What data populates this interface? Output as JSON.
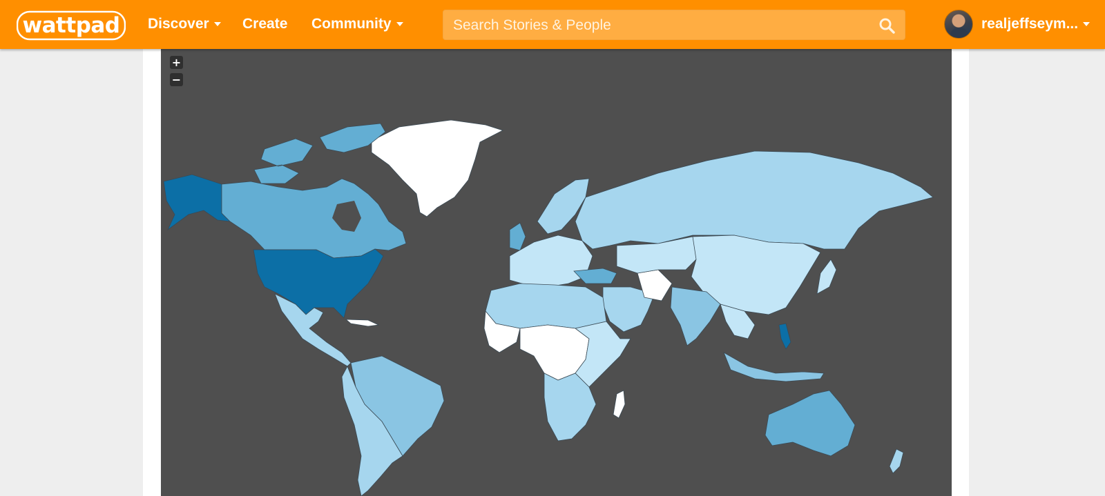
{
  "header": {
    "logo_text": "wattpad",
    "nav": {
      "discover": "Discover",
      "create": "Create",
      "community": "Community"
    },
    "search_placeholder": "Search Stories & People",
    "username": "realjeffseym..."
  },
  "map": {
    "zoom_in": "+",
    "zoom_out": "−"
  },
  "colors": {
    "header": "#ff8f00",
    "search_bg": "#ffad42",
    "ocean": "#4f4f4f",
    "darkest_blue": "#0c6fa6",
    "mid_blue": "#63aed3",
    "light_blue": "#a6d6ee",
    "lightest_blue": "#c3e6f7",
    "none": "#ffffff"
  },
  "icons": [
    "wattpad-logo",
    "chevron-down-icon",
    "search-icon",
    "avatar",
    "zoom-in-icon",
    "zoom-out-icon"
  ]
}
